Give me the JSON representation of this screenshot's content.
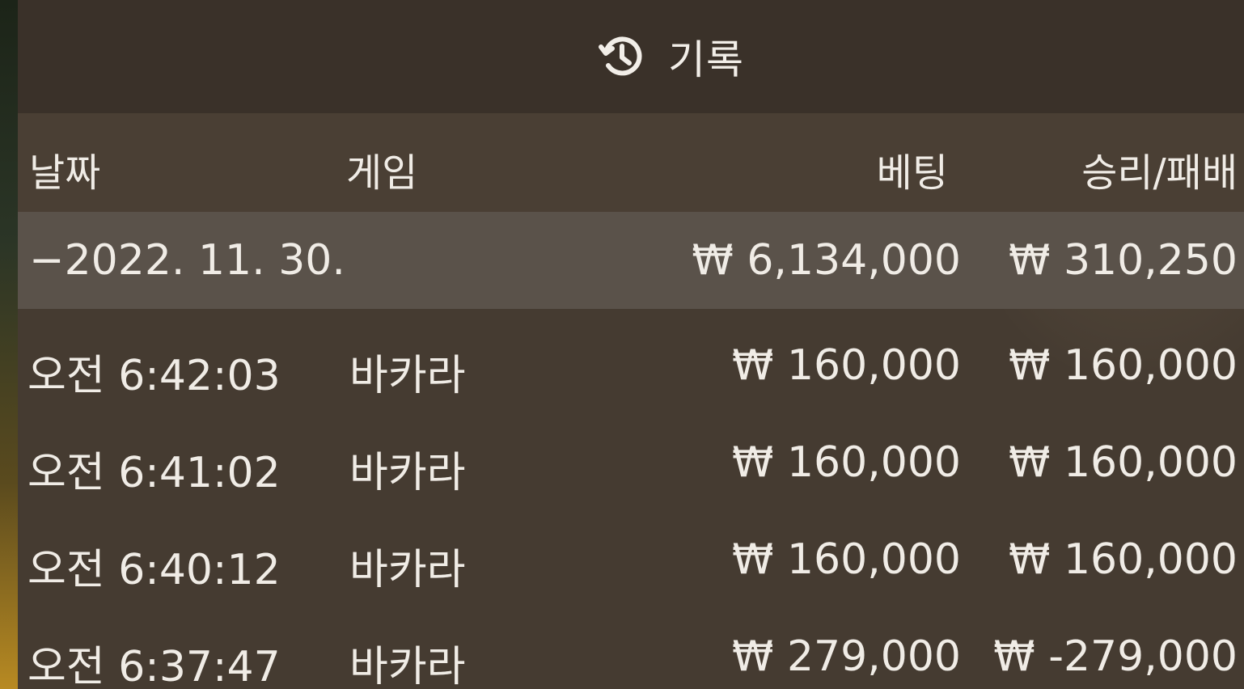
{
  "header": {
    "title": "기록",
    "icon": "history-icon"
  },
  "columns": {
    "date": "날짜",
    "game": "게임",
    "bet": "베팅",
    "result": "승리/패배"
  },
  "summary": {
    "date": "−2022. 11. 30.",
    "bet": "₩ 6,134,000",
    "result": "₩ 310,250"
  },
  "rows": [
    {
      "time": "오전 6:42:03",
      "game": "바카라",
      "bet": "₩ 160,000",
      "result": "₩ 160,000"
    },
    {
      "time": "오전 6:41:02",
      "game": "바카라",
      "bet": "₩ 160,000",
      "result": "₩ 160,000"
    },
    {
      "time": "오전 6:40:12",
      "game": "바카라",
      "bet": "₩ 160,000",
      "result": "₩ 160,000"
    },
    {
      "time": "오전 6:37:47",
      "game": "바카라",
      "bet": "₩ 279,000",
      "result": "₩ -279,000"
    }
  ],
  "colors": {
    "panel_bg": "#453b31",
    "title_bg": "#3a3129",
    "header_bg": "#4a3f34",
    "summary_bg": "#5a524a",
    "text": "#f0ece6"
  }
}
